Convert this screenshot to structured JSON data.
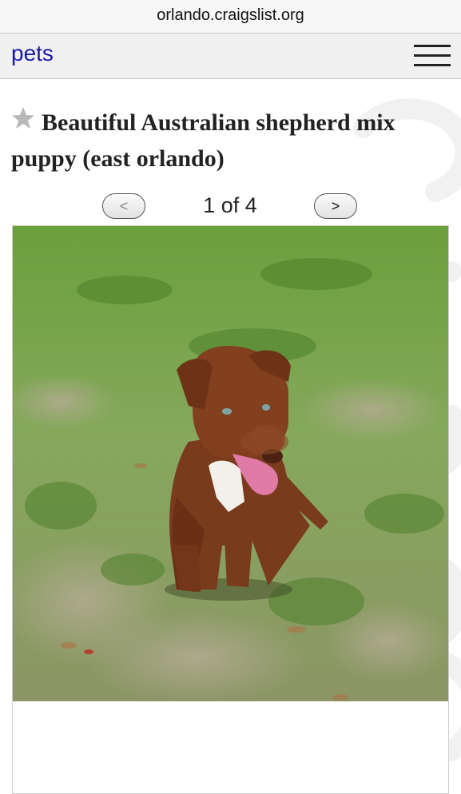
{
  "browser": {
    "url": "orlando.craigslist.org"
  },
  "nav": {
    "category_label": "pets",
    "menu_icon": "hamburger-menu-icon"
  },
  "posting": {
    "title": "Beautiful Australian shepherd mix puppy (east orlando)",
    "favorite_icon": "star-icon"
  },
  "gallery": {
    "prev_label": "<",
    "next_label": ">",
    "counter": "1 of 4",
    "current_image": 1,
    "total_images": 4
  },
  "colors": {
    "link": "#1a1aa6",
    "navbar_bg": "#f0f0f0",
    "urlbar_bg": "#f7f7f7",
    "grass": "#6f9a3e",
    "dog_fur": "#7a3a1c"
  }
}
